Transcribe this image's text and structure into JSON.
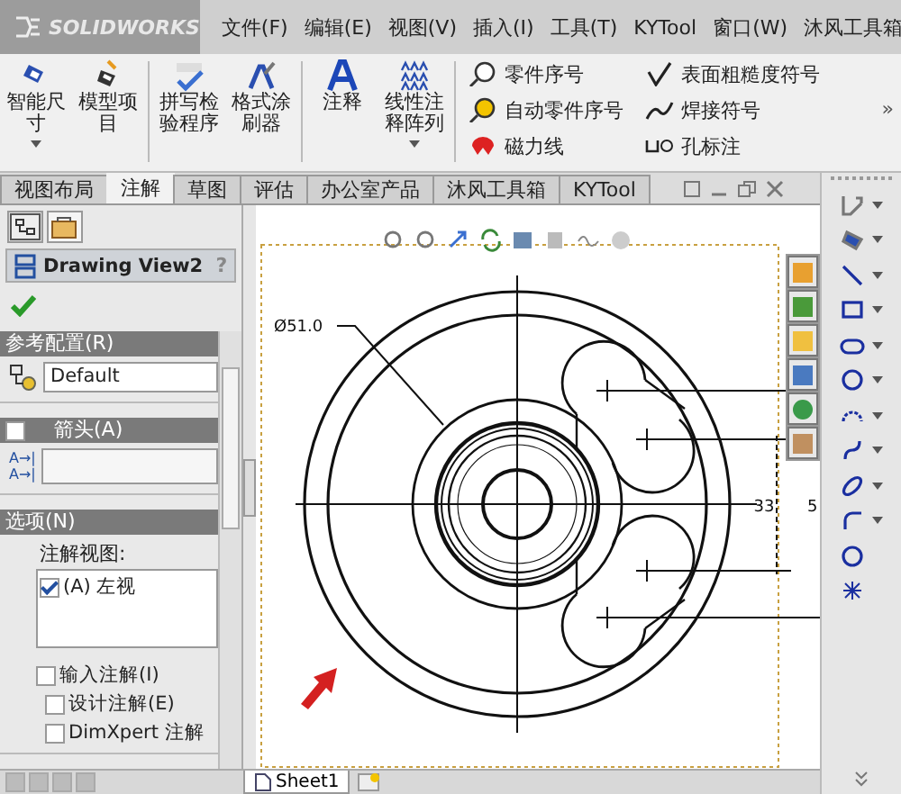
{
  "app_bar": {
    "logo": "SOLIDWORKS",
    "menu": [
      "文件(F)",
      "编辑(E)",
      "视图(V)",
      "插入(I)",
      "工具(T)",
      "KYTool",
      "窗口(W)",
      "沐风工具箱"
    ]
  },
  "ribbon": {
    "groups": [
      [
        {
          "kind": "smart-dimension",
          "label": "智能尺寸",
          "dropdown": true
        },
        {
          "kind": "model-items",
          "label": "模型项目",
          "dropdown": false
        }
      ],
      [
        {
          "kind": "spell-check",
          "label": "拼写检验程序",
          "dropdown": false
        },
        {
          "kind": "format-painter",
          "label": "格式涂刷器",
          "dropdown": false
        }
      ],
      [
        {
          "kind": "note",
          "label": "注释",
          "dropdown": false
        },
        {
          "kind": "linear-pattern",
          "label": "线性注释阵列",
          "dropdown": true
        }
      ]
    ],
    "small_columns": [
      [
        {
          "kind": "balloon",
          "label": "零件序号"
        },
        {
          "kind": "auto-balloon",
          "label": "自动零件序号"
        },
        {
          "kind": "magnetic-line",
          "label": "磁力线"
        }
      ],
      [
        {
          "kind": "surface-finish",
          "label": "表面粗糙度符号"
        },
        {
          "kind": "weld",
          "label": "焊接符号"
        },
        {
          "kind": "hole-callout",
          "label": "孔标注"
        }
      ]
    ],
    "overflow": "»"
  },
  "tabs": [
    {
      "label": "视图布局",
      "selected": false
    },
    {
      "label": "注解",
      "selected": true
    },
    {
      "label": "草图",
      "selected": false
    },
    {
      "label": "评估",
      "selected": false
    },
    {
      "label": "办公室产品",
      "selected": false
    },
    {
      "label": "沐风工具箱",
      "selected": false
    },
    {
      "label": "KYTool",
      "selected": false
    }
  ],
  "property_manager": {
    "title": "Drawing View2",
    "help": "?",
    "reference_configuration": {
      "header": "参考配置(R)",
      "value": "Default"
    },
    "arrow": {
      "header": "箭头(A)",
      "checked": false,
      "field_icons": [
        "A→|",
        "A→|"
      ]
    },
    "options": {
      "header": "选项(N)",
      "list_label": "注解视图:",
      "views": [
        {
          "label": "(A) 左视",
          "checked": true
        }
      ],
      "checks": [
        {
          "label": "输入注解(I)",
          "checked": false,
          "children": [
            {
              "label": "设计注解(E)",
              "checked": false
            },
            {
              "label": "DimXpert 注解",
              "checked": false
            }
          ]
        }
      ]
    }
  },
  "drawing": {
    "diameter_label": "Ø51.0",
    "dimension_labels": [
      "33",
      "5"
    ]
  },
  "sheet_tabs": [
    {
      "label": "Sheet1",
      "selected": true
    }
  ]
}
